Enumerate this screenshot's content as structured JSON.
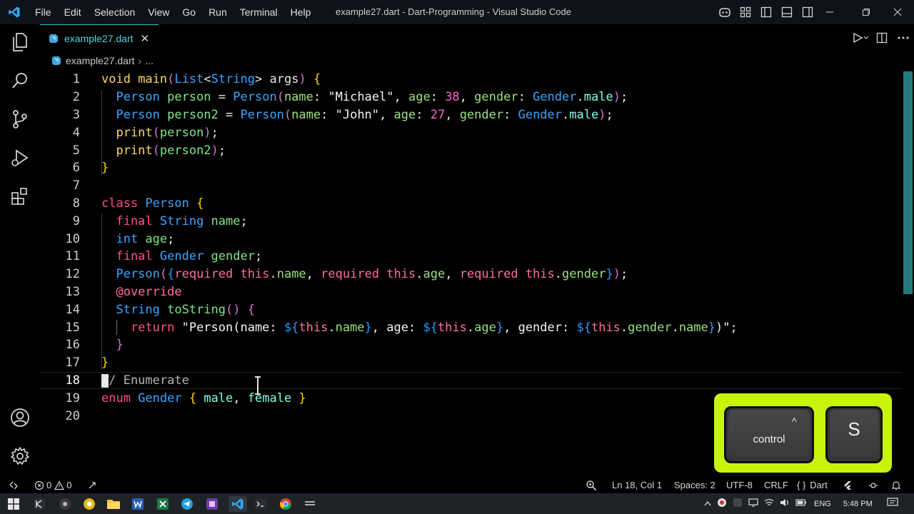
{
  "window": {
    "title": "example27.dart - Dart-Programming - Visual Studio Code",
    "menu": [
      "File",
      "Edit",
      "Selection",
      "View",
      "Go",
      "Run",
      "Terminal",
      "Help"
    ]
  },
  "tab": {
    "label": "example27.dart",
    "close": "✕"
  },
  "breadcrumb": {
    "file": "example27.dart",
    "sep": "›",
    "more": "..."
  },
  "lines": [
    {
      "n": "1",
      "t": [
        [
          "void ",
          "k-void"
        ],
        [
          "main",
          "fn"
        ],
        [
          "(",
          "br2"
        ],
        [
          "List",
          "ty"
        ],
        [
          "<",
          "plain"
        ],
        [
          "String",
          "ty"
        ],
        [
          "> ",
          "plain"
        ],
        [
          "args",
          "pa"
        ],
        [
          ")",
          "br2"
        ],
        [
          " {",
          "br1"
        ]
      ]
    },
    {
      "n": "2",
      "t": [
        [
          "  Person ",
          "cls"
        ],
        [
          "person",
          "var"
        ],
        [
          " = ",
          "plain"
        ],
        [
          "Person",
          "cls"
        ],
        [
          "(",
          "br2"
        ],
        [
          "name",
          "prop"
        ],
        [
          ": ",
          "plain"
        ],
        [
          "\"Michael\"",
          "str"
        ],
        [
          ", ",
          "plain"
        ],
        [
          "age",
          "prop"
        ],
        [
          ": ",
          "plain"
        ],
        [
          "38",
          "num"
        ],
        [
          ", ",
          "plain"
        ],
        [
          "gender",
          "prop"
        ],
        [
          ": ",
          "plain"
        ],
        [
          "Gender",
          "cls"
        ],
        [
          ".",
          "plain"
        ],
        [
          "male",
          "en"
        ],
        [
          ")",
          "br2"
        ],
        [
          ";",
          "plain"
        ]
      ]
    },
    {
      "n": "3",
      "t": [
        [
          "  Person ",
          "cls"
        ],
        [
          "person2",
          "var"
        ],
        [
          " = ",
          "plain"
        ],
        [
          "Person",
          "cls"
        ],
        [
          "(",
          "br2"
        ],
        [
          "name",
          "prop"
        ],
        [
          ": ",
          "plain"
        ],
        [
          "\"John\"",
          "str"
        ],
        [
          ", ",
          "plain"
        ],
        [
          "age",
          "prop"
        ],
        [
          ": ",
          "plain"
        ],
        [
          "27",
          "num"
        ],
        [
          ", ",
          "plain"
        ],
        [
          "gender",
          "prop"
        ],
        [
          ": ",
          "plain"
        ],
        [
          "Gender",
          "cls"
        ],
        [
          ".",
          "plain"
        ],
        [
          "male",
          "en"
        ],
        [
          ")",
          "br2"
        ],
        [
          ";",
          "plain"
        ]
      ]
    },
    {
      "n": "4",
      "t": [
        [
          "  print",
          "fn"
        ],
        [
          "(",
          "br2"
        ],
        [
          "person",
          "var"
        ],
        [
          ")",
          "br2"
        ],
        [
          ";",
          "plain"
        ]
      ]
    },
    {
      "n": "5",
      "t": [
        [
          "  print",
          "fn"
        ],
        [
          "(",
          "br2"
        ],
        [
          "person2",
          "var"
        ],
        [
          ")",
          "br2"
        ],
        [
          ";",
          "plain"
        ]
      ]
    },
    {
      "n": "6",
      "t": [
        [
          "}",
          "br1"
        ]
      ]
    },
    {
      "n": "7",
      "t": []
    },
    {
      "n": "8",
      "t": [
        [
          "class ",
          "kw"
        ],
        [
          "Person",
          "cls"
        ],
        [
          " {",
          "br1"
        ]
      ]
    },
    {
      "n": "9",
      "t": [
        [
          "  final ",
          "kw"
        ],
        [
          "String ",
          "ty"
        ],
        [
          "name",
          "var"
        ],
        [
          ";",
          "plain"
        ]
      ]
    },
    {
      "n": "10",
      "t": [
        [
          "  int ",
          "ty"
        ],
        [
          "age",
          "var"
        ],
        [
          ";",
          "plain"
        ]
      ]
    },
    {
      "n": "11",
      "t": [
        [
          "  final ",
          "kw"
        ],
        [
          "Gender ",
          "cls"
        ],
        [
          "gender",
          "var"
        ],
        [
          ";",
          "plain"
        ]
      ]
    },
    {
      "n": "12",
      "t": [
        [
          "  Person",
          "cls"
        ],
        [
          "(",
          "br2"
        ],
        [
          "{",
          "br3"
        ],
        [
          "required ",
          "kw2"
        ],
        [
          "this",
          "th"
        ],
        [
          ".",
          "plain"
        ],
        [
          "name",
          "prop"
        ],
        [
          ", ",
          "plain"
        ],
        [
          "required ",
          "kw2"
        ],
        [
          "this",
          "th"
        ],
        [
          ".",
          "plain"
        ],
        [
          "age",
          "prop"
        ],
        [
          ", ",
          "plain"
        ],
        [
          "required ",
          "kw2"
        ],
        [
          "this",
          "th"
        ],
        [
          ".",
          "plain"
        ],
        [
          "gender",
          "prop"
        ],
        [
          "}",
          "br3"
        ],
        [
          ")",
          "br2"
        ],
        [
          ";",
          "plain"
        ]
      ]
    },
    {
      "n": "13",
      "t": [
        [
          "  @override",
          "an"
        ]
      ]
    },
    {
      "n": "14",
      "t": [
        [
          "  String ",
          "ty"
        ],
        [
          "toString",
          "var"
        ],
        [
          "()",
          "br2"
        ],
        [
          " {",
          "br2"
        ]
      ]
    },
    {
      "n": "15",
      "t": [
        [
          "    return ",
          "kw"
        ],
        [
          "\"Person(name: ",
          "str"
        ],
        [
          "${",
          "br3"
        ],
        [
          "this",
          "th"
        ],
        [
          ".",
          "plain"
        ],
        [
          "name",
          "prop"
        ],
        [
          "}",
          "br3"
        ],
        [
          ", age: ",
          "str"
        ],
        [
          "${",
          "br3"
        ],
        [
          "this",
          "th"
        ],
        [
          ".",
          "plain"
        ],
        [
          "age",
          "prop"
        ],
        [
          "}",
          "br3"
        ],
        [
          ", gender: ",
          "str"
        ],
        [
          "${",
          "br3"
        ],
        [
          "this",
          "th"
        ],
        [
          ".",
          "plain"
        ],
        [
          "gender",
          "prop"
        ],
        [
          ".",
          "plain"
        ],
        [
          "name",
          "prop"
        ],
        [
          "}",
          "br3"
        ],
        [
          ")\"",
          "str"
        ],
        [
          ";",
          "plain"
        ]
      ]
    },
    {
      "n": "16",
      "t": [
        [
          "  }",
          "br2"
        ]
      ]
    },
    {
      "n": "17",
      "t": [
        [
          "}",
          "br1"
        ]
      ]
    },
    {
      "n": "18",
      "t": [
        [
          "// Enumerate",
          "cm"
        ]
      ]
    },
    {
      "n": "19",
      "t": [
        [
          "enum ",
          "kw"
        ],
        [
          "Gender ",
          "cls"
        ],
        [
          "{ ",
          "br1"
        ],
        [
          "male",
          "fl"
        ],
        [
          ", ",
          "plain"
        ],
        [
          "female",
          "fl"
        ],
        [
          " }",
          "br1"
        ]
      ]
    },
    {
      "n": "20",
      "t": []
    }
  ],
  "status": {
    "errors": "0",
    "warnings": "0",
    "position": "Ln 18, Col 1",
    "spaces": "Spaces: 2",
    "encoding": "UTF-8",
    "eol": "CRLF",
    "language": "Dart"
  },
  "keys": {
    "modifier": "control",
    "modifier_glyph": "^",
    "letter": "S"
  },
  "taskbar": {
    "lang": "ENG",
    "time": "5:48 PM"
  },
  "colors": {
    "accent": "#1ec8c8",
    "overlay": "#c8f40c"
  }
}
